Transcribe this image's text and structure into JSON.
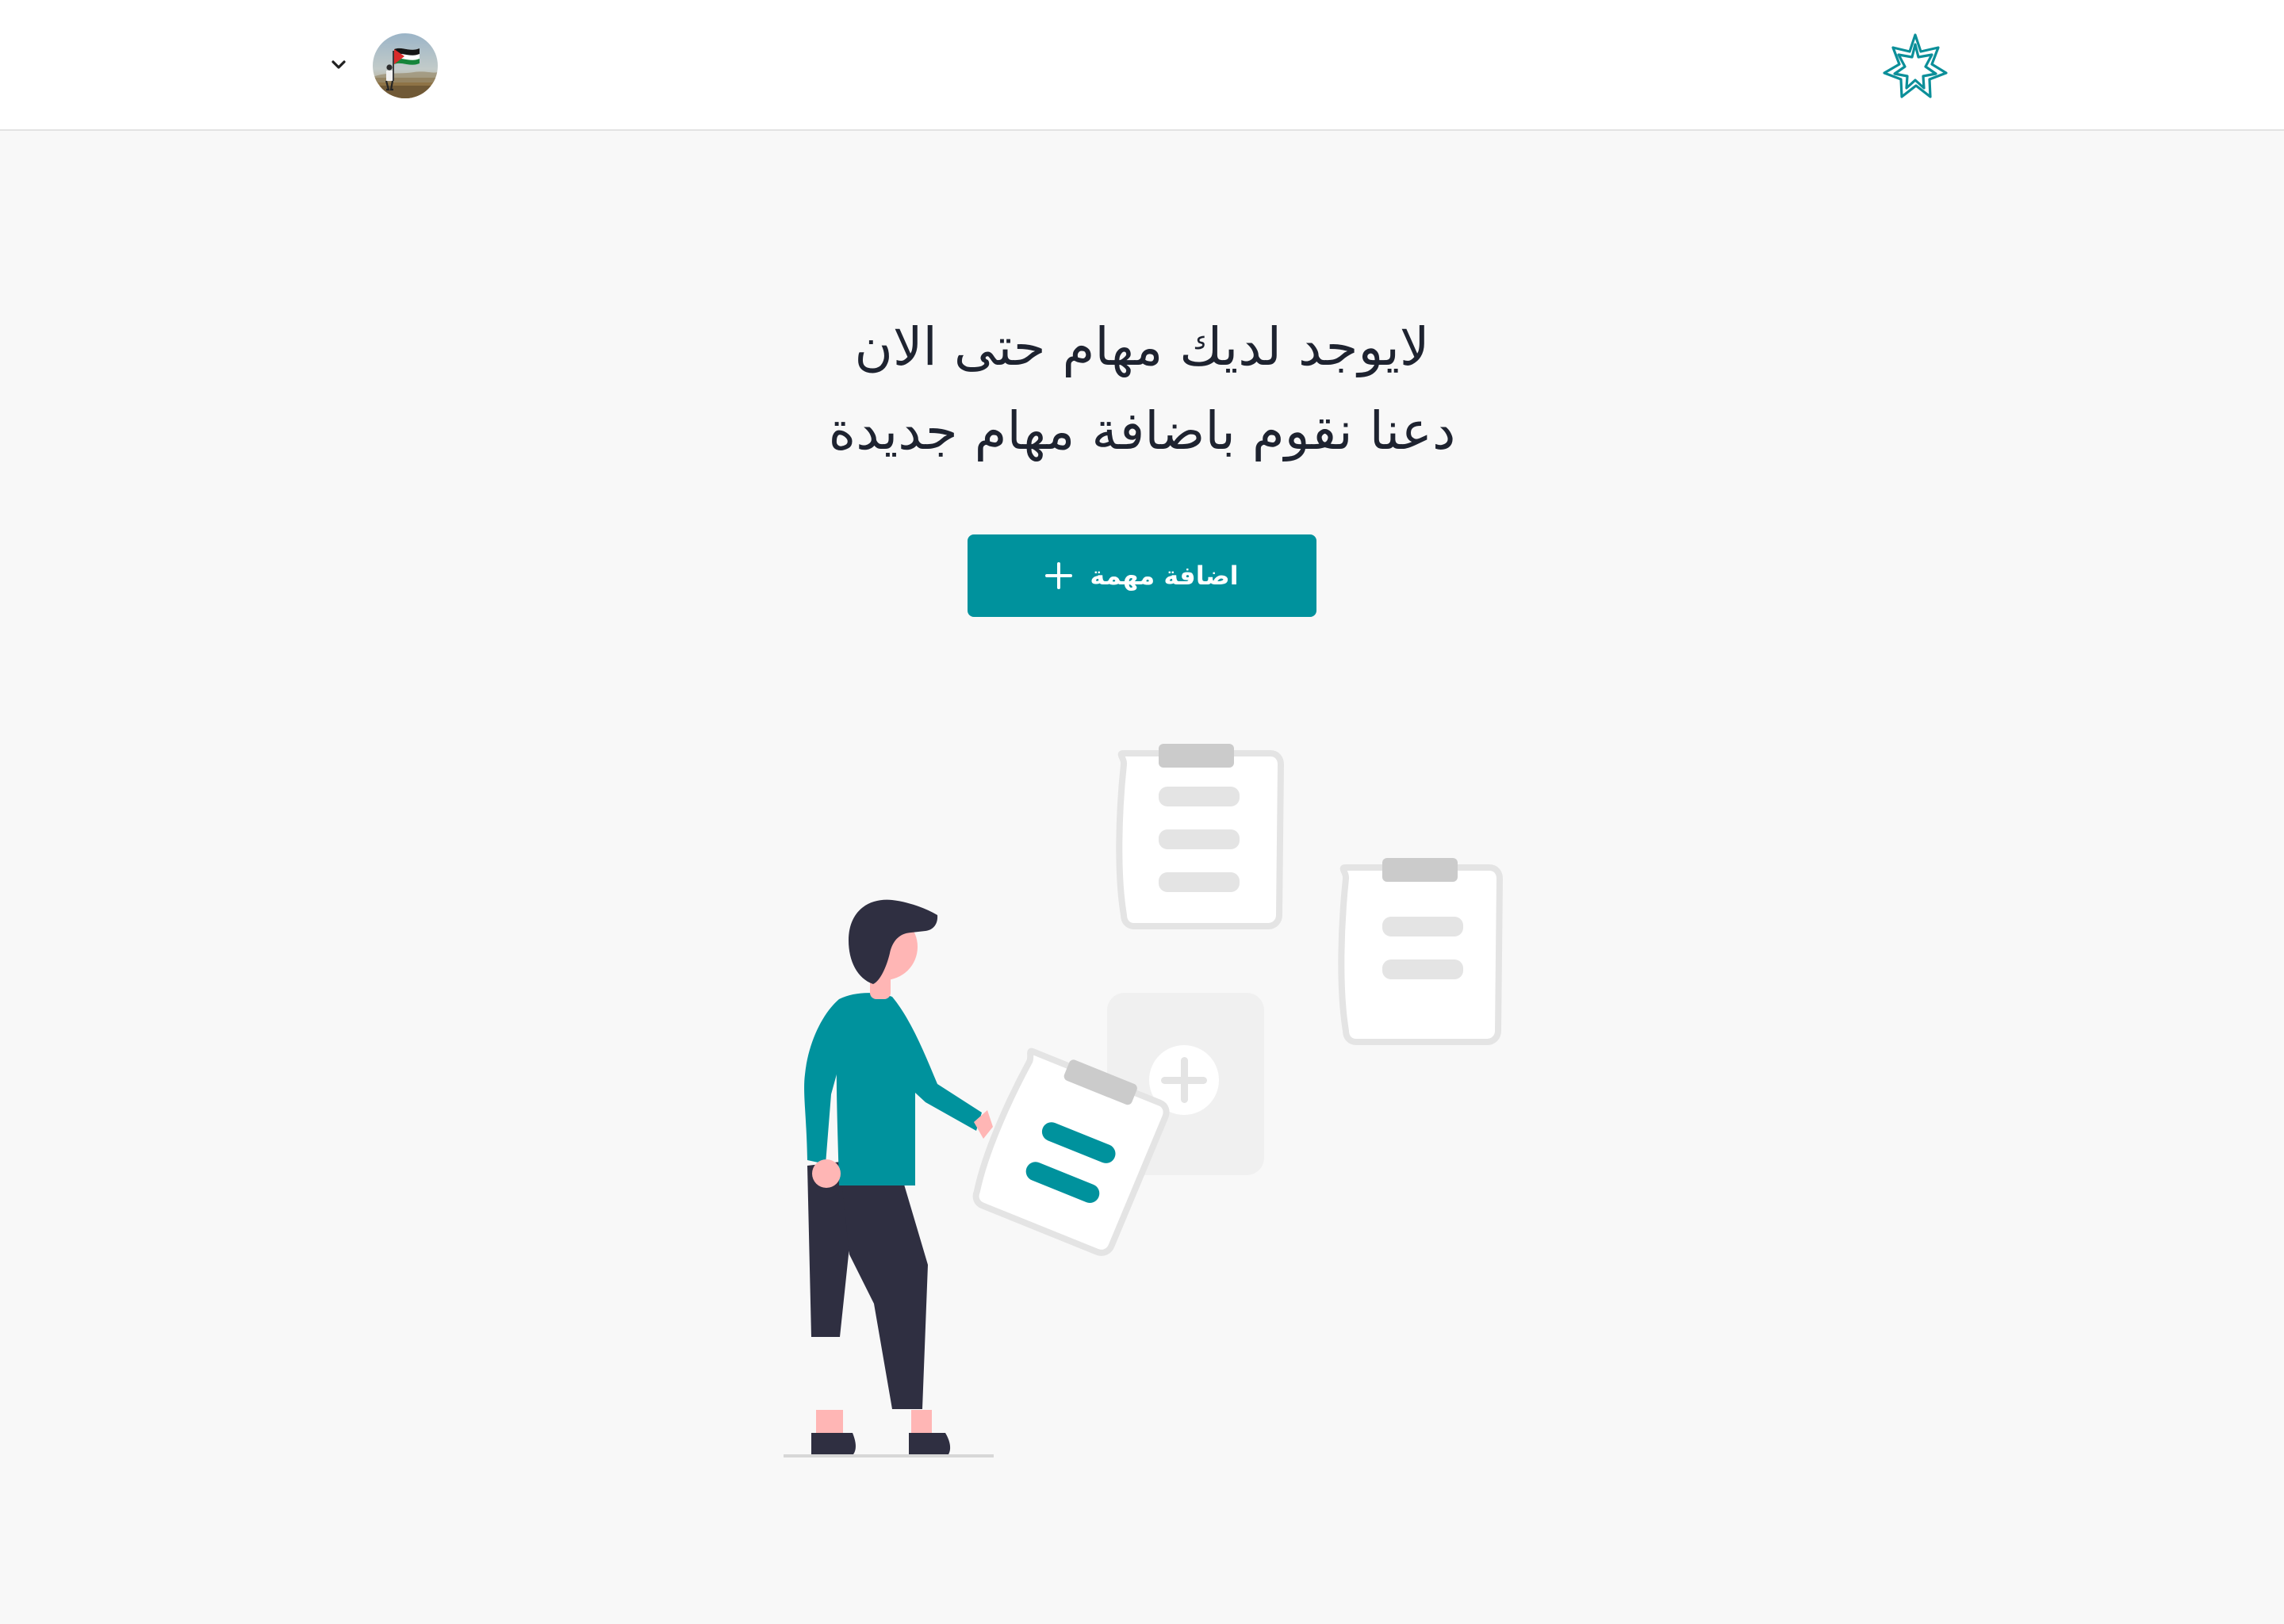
{
  "header": {
    "logo_icon": "app-logo-icon",
    "user_avatar_icon": "user-avatar",
    "menu_icon": "chevron-down-icon"
  },
  "empty_state": {
    "title_line1": "لايوجد لديك مهام حتى الان",
    "title_line2": "دعنا نقوم باضافة مهام جديدة"
  },
  "actions": {
    "add_task_label": "اضافة مهمة",
    "add_task_icon": "plus-icon"
  },
  "theme": {
    "accent": "#00929d",
    "background": "#f8f8f8",
    "header_background": "#ffffff",
    "text": "#1e2330"
  }
}
